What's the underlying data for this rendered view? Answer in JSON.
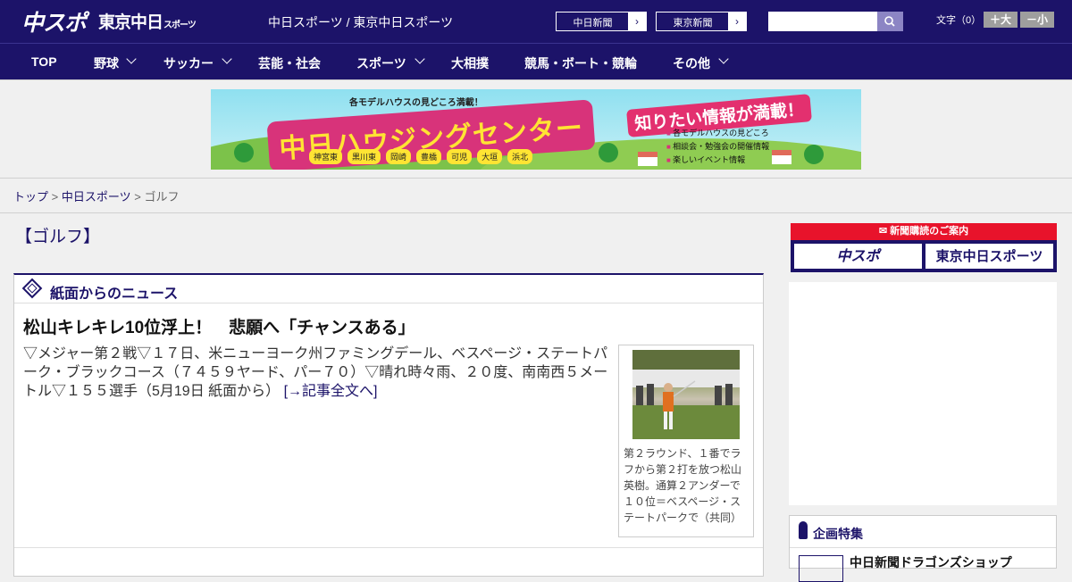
{
  "header": {
    "logo_chuspo": "中スポ",
    "logo_tokyo": "東京中日",
    "logo_tokyo_small": "スポーツ",
    "tagline": "中日スポーツ / 東京中日スポーツ",
    "btn_chunichi": "中日新聞",
    "btn_tokyo": "東京新聞",
    "search_placeholder": "",
    "font_size_label": "文字（0）",
    "font_bigger": "＋大",
    "font_smaller": "－小"
  },
  "nav": {
    "items": [
      "TOP",
      "野球",
      "サッカー",
      "芸能・社会",
      "スポーツ",
      "大相撲",
      "競馬・ボート・競輪",
      "その他"
    ]
  },
  "banner": {
    "top_text": "各モデルハウスの見どころ満載！",
    "main_text": "中日ハウジングセンター",
    "right_text": "知りたい情報が満載！",
    "chips": [
      "神宮東",
      "黒川東",
      "岡崎",
      "豊橋",
      "可児",
      "大垣",
      "浜北"
    ],
    "list": [
      "各モデルハウスの見どころ",
      "相談会・勉強会の開催情報",
      "楽しいイベント情報"
    ]
  },
  "breadcrumb": {
    "top": "トップ",
    "section": "中日スポーツ",
    "current": "ゴルフ",
    "sep": ">"
  },
  "main": {
    "category": "【ゴルフ】",
    "box_title": "紙面からのニュース",
    "headline": "松山キレキレ10位浮上！　悲願へ「チャンスある」",
    "body": "▽メジャー第２戦▽１７日、米ニューヨーク州ファミングデール、ベスページ・ステートパーク・ブラックコース（７４５９ヤード、パー７０）▽晴れ時々雨、２０度、南南西５メートル▽１５５選手（5月19日 紙面から）",
    "read_more": "[→記事全文へ]",
    "photo_caption": "第２ラウンド、１番でラフから第２打を放つ松山英樹。通算２アンダーで１０位＝ベスページ・ステートパークで（共同）"
  },
  "sidebar": {
    "sub_title": "新聞購読のご案内",
    "sub_chuspo": "中スポ",
    "sub_tokyo": "東京中日スポーツ",
    "feature_title": "企画特集",
    "feature_item": "中日新聞ドラゴンズショップ"
  }
}
